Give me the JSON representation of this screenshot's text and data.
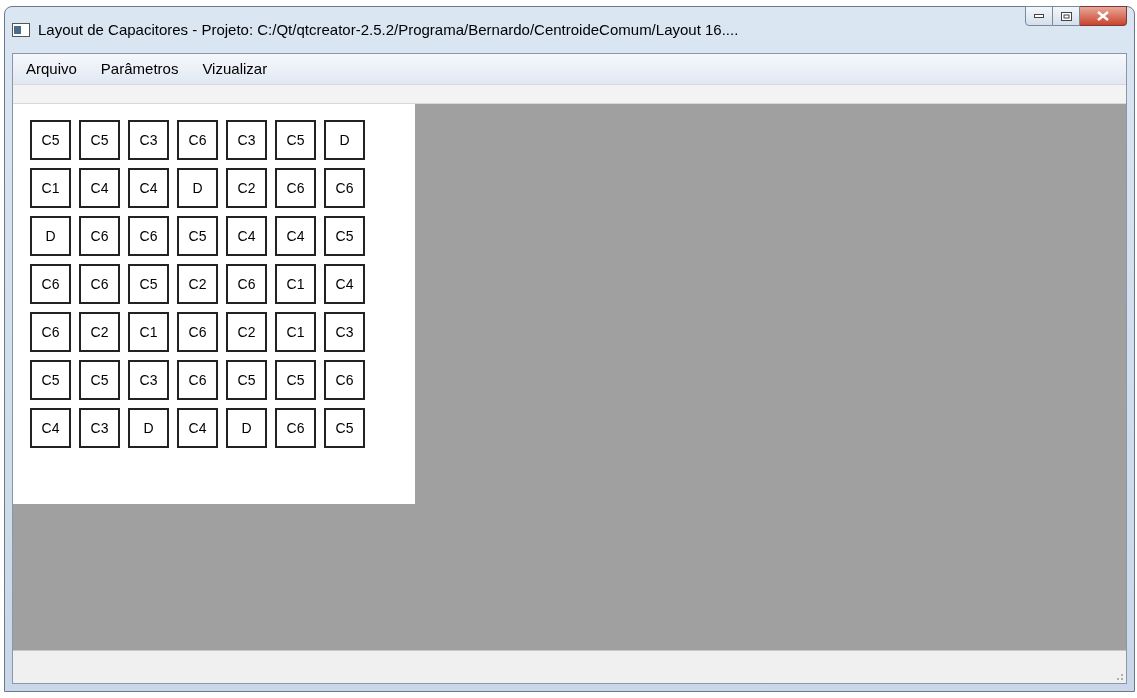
{
  "window": {
    "title": "Layout de Capacitores  - Projeto: C:/Qt/qtcreator-2.5.2/Programa/Bernardo/CentroideComum/Layout 16...."
  },
  "menu": [
    "Arquivo",
    "Parâmetros",
    "Vizualizar"
  ],
  "grid": [
    [
      "C5",
      "C5",
      "C3",
      "C6",
      "C3",
      "C5",
      "D"
    ],
    [
      "C1",
      "C4",
      "C4",
      "D",
      "C2",
      "C6",
      "C6"
    ],
    [
      "D",
      "C6",
      "C6",
      "C5",
      "C4",
      "C4",
      "C5"
    ],
    [
      "C6",
      "C6",
      "C5",
      "C2",
      "C6",
      "C1",
      "C4"
    ],
    [
      "C6",
      "C2",
      "C1",
      "C6",
      "C2",
      "C1",
      "C3"
    ],
    [
      "C5",
      "C5",
      "C3",
      "C6",
      "C5",
      "C5",
      "C6"
    ],
    [
      "C4",
      "C3",
      "D",
      "C4",
      "D",
      "C6",
      "C5"
    ]
  ]
}
